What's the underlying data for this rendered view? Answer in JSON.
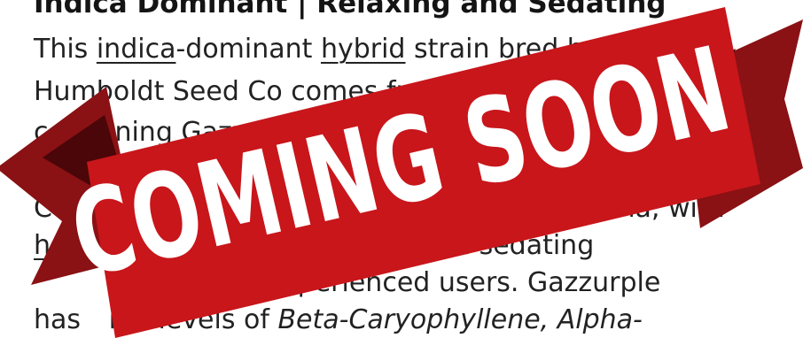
{
  "article": {
    "heading": "Indica Dominant | Relaxing and Sedating",
    "line1": {
      "prefix": "This ",
      "link1": "indica",
      "middle": "-dominant ",
      "link2": "hybrid",
      "suffix": " strain bred by"
    },
    "line2": "Humboldt Seed Co comes from",
    "line3": "combining Gazzurple",
    "line5": {
      "prefix": "C",
      "suffix": "oma, with"
    },
    "line6": {
      "link": "h",
      "suffix": "s can be a sedating"
    },
    "line7": "experienced users. Gazzurple",
    "line8": {
      "prefix": "has ",
      "middle": "igh levels of ",
      "italic": "Beta-Caryophyllene, Alpha-"
    }
  },
  "banner": {
    "text": "COMING SOON",
    "colors": {
      "ribbon_main": "#c8161b",
      "ribbon_tail": "#8a1114",
      "ribbon_fold": "#4a0608",
      "text": "#ffffff"
    }
  }
}
